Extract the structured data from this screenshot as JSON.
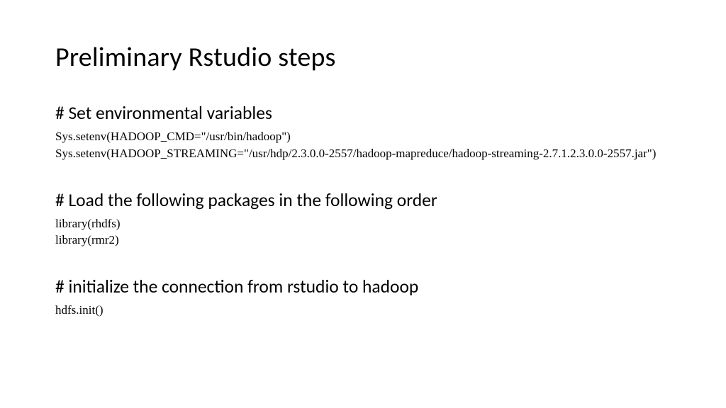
{
  "title": "Preliminary Rstudio steps",
  "sections": [
    {
      "heading": "# Set environmental variables",
      "lines": [
        "Sys.setenv(HADOOP_CMD=\"/usr/bin/hadoop\")",
        "Sys.setenv(HADOOP_STREAMING=\"/usr/hdp/2.3.0.0-2557/hadoop-mapreduce/hadoop-streaming-2.7.1.2.3.0.0-2557.jar\")"
      ]
    },
    {
      "heading": "# Load the following packages in the following order",
      "lines": [
        "library(rhdfs)",
        "library(rmr2)"
      ]
    },
    {
      "heading": "# initialize the connection from rstudio to hadoop",
      "lines": [
        "hdfs.init()"
      ]
    }
  ]
}
